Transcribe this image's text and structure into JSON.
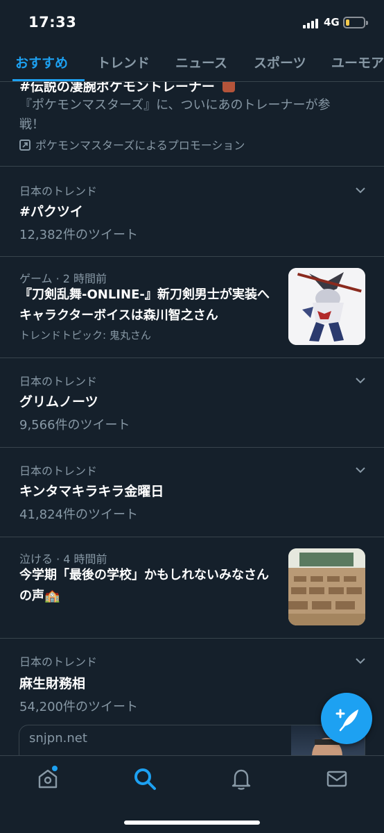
{
  "status_bar": {
    "time": "17:33",
    "network": "4G",
    "battery_level": 0.2
  },
  "tabs": [
    {
      "label": "おすすめ",
      "active": true
    },
    {
      "label": "トレンド",
      "active": false
    },
    {
      "label": "ニュース",
      "active": false
    },
    {
      "label": "スポーツ",
      "active": false
    },
    {
      "label": "ユーモア",
      "active": false
    }
  ],
  "promo": {
    "title": "#伝説の凄腕ポケモントレーナー",
    "description": "『ポケモンマスターズ』に、ついにあのトレーナーが参戦！",
    "promoted_by": "ポケモンマスターズによるプロモーション"
  },
  "trends": [
    {
      "context": "日本のトレンド",
      "name": "#パクツイ",
      "count": "12,382件のツイート"
    },
    {
      "context": "ゲーム · 2 時間前",
      "headline": "『刀剣乱舞-ONLINE-』新刀剣男士が実装へ キャラクターボイスは森川智之さん",
      "topic": "トレンドトピック: 鬼丸さん"
    },
    {
      "context": "日本のトレンド",
      "name": "グリムノーツ",
      "count": "9,566件のツイート"
    },
    {
      "context": "日本のトレンド",
      "name": "キンタマキラキラ金曜日",
      "count": "41,824件のツイート"
    },
    {
      "context": "泣ける · 4 時間前",
      "headline": "今学期「最後の学校」かもしれないみなさんの声🏫"
    },
    {
      "context": "日本のトレンド",
      "name": "麻生財務相",
      "count": "54,200件のツイート"
    }
  ],
  "link_card": {
    "domain": "snjpn.net"
  },
  "colors": {
    "background": "#15202b",
    "accent": "#1da1f2",
    "secondary_text": "#8899a6",
    "divider": "#38444d"
  },
  "nav_icons": [
    "home-icon",
    "search-icon",
    "bell-icon",
    "mail-icon"
  ]
}
